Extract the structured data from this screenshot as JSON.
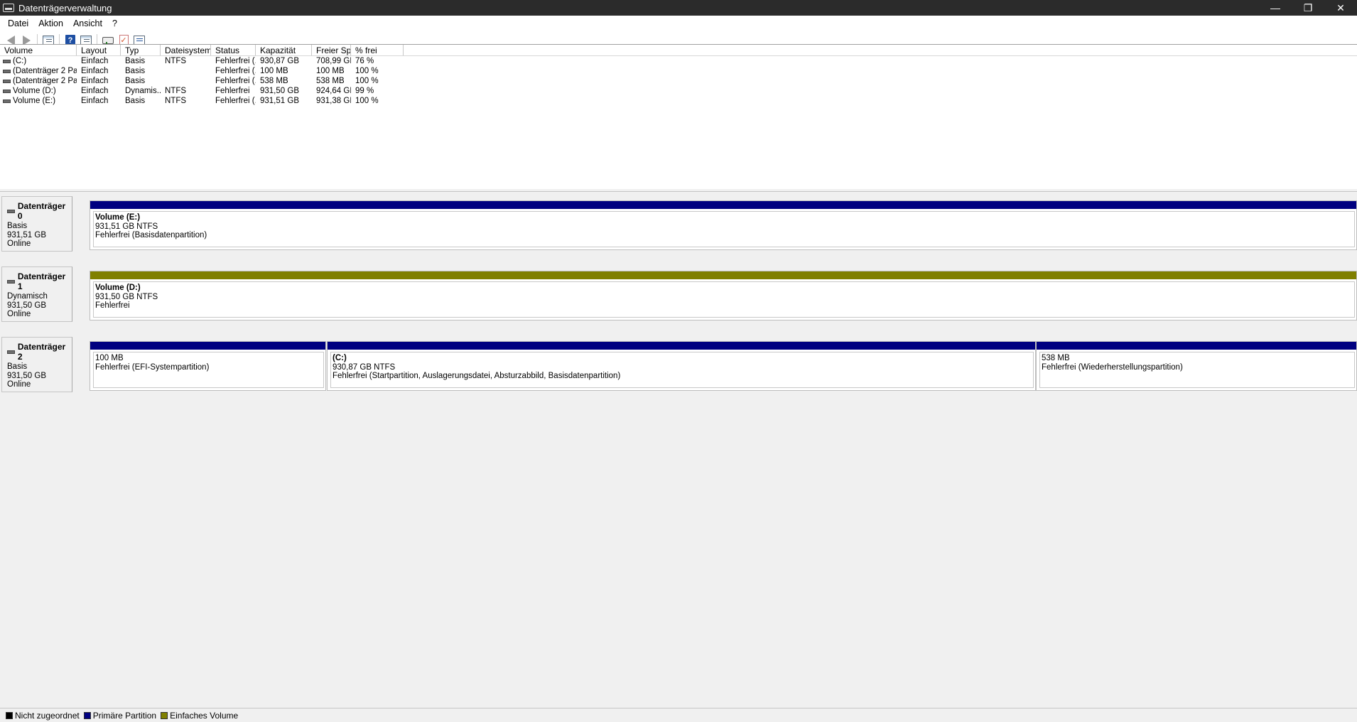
{
  "window": {
    "title": "Datenträgerverwaltung",
    "minimize": "—",
    "restore": "❐",
    "close": "✕"
  },
  "menu": [
    "Datei",
    "Aktion",
    "Ansicht",
    "?"
  ],
  "toolbar": [
    "back-icon",
    "forward-icon",
    "disk-list-icon",
    "help-icon",
    "console-tree-icon",
    "connect-icon",
    "checklist-icon",
    "properties-icon"
  ],
  "volume_list": {
    "columns": [
      "Volume",
      "Layout",
      "Typ",
      "Dateisystem",
      "Status",
      "Kapazität",
      "Freier Sp...",
      "% frei"
    ],
    "rows": [
      [
        "(C:)",
        "Einfach",
        "Basis",
        "NTFS",
        "Fehlerfrei (...",
        "930,87 GB",
        "708,99 GB",
        "76 %"
      ],
      [
        "(Datenträger 2 Par...",
        "Einfach",
        "Basis",
        "",
        "Fehlerfrei (...",
        "100 MB",
        "100 MB",
        "100 %"
      ],
      [
        "(Datenträger 2 Par...",
        "Einfach",
        "Basis",
        "",
        "Fehlerfrei (...",
        "538 MB",
        "538 MB",
        "100 %"
      ],
      [
        "Volume (D:)",
        "Einfach",
        "Dynamis...",
        "NTFS",
        "Fehlerfrei",
        "931,50 GB",
        "924,64 GB",
        "99 %"
      ],
      [
        "Volume (E:)",
        "Einfach",
        "Basis",
        "NTFS",
        "Fehlerfrei (...",
        "931,51 GB",
        "931,38 GB",
        "100 %"
      ]
    ]
  },
  "disks": [
    {
      "name": "Datenträger 0",
      "type": "Basis",
      "size": "931,51 GB",
      "state": "Online",
      "partitions": [
        {
          "name": "Volume  (E:)",
          "size": "931,51 GB NTFS",
          "status": "Fehlerfrei (Basisdatenpartition)",
          "bar_color": "#000080"
        }
      ]
    },
    {
      "name": "Datenträger 1",
      "type": "Dynamisch",
      "size": "931,50 GB",
      "state": "Online",
      "partitions": [
        {
          "name": "Volume  (D:)",
          "size": "931,50 GB NTFS",
          "status": "Fehlerfrei",
          "bar_color": "#808000"
        }
      ]
    },
    {
      "name": "Datenträger 2",
      "type": "Basis",
      "size": "931,50 GB",
      "state": "Online",
      "partitions": [
        {
          "name": "",
          "size": "100 MB",
          "status": "Fehlerfrei (EFI-Systempartition)",
          "bar_color": "#000080"
        },
        {
          "name": "(C:)",
          "size": "930,87 GB NTFS",
          "status": "Fehlerfrei (Startpartition, Auslagerungsdatei, Absturzabbild, Basisdatenpartition)",
          "bar_color": "#000080"
        },
        {
          "name": "",
          "size": "538 MB",
          "status": "Fehlerfrei (Wiederherstellungspartition)",
          "bar_color": "#000080"
        }
      ]
    }
  ],
  "legend": [
    {
      "label": "Nicht zugeordnet",
      "color": "#000000"
    },
    {
      "label": "Primäre Partition",
      "color": "#000080"
    },
    {
      "label": "Einfaches Volume",
      "color": "#808000"
    }
  ]
}
